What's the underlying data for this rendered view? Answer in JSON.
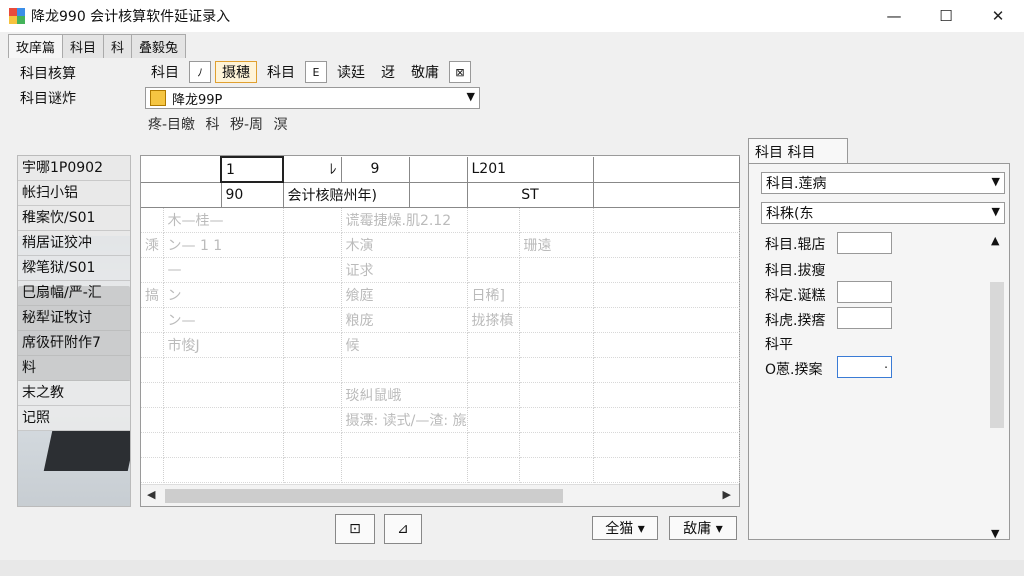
{
  "window": {
    "title": "降龙990 会计核算软件延证录入",
    "minimize": "—",
    "maximize": "☐",
    "close": "✕"
  },
  "tabs": [
    "玫庠篇",
    "科目",
    "科",
    "叠毅兔"
  ],
  "left_labels": [
    "科目核算",
    "科目谜炸"
  ],
  "toolbar": {
    "item1": "科目",
    "item2": "ﾉ",
    "item3": "摄穗",
    "item4": "科目",
    "item5": "E",
    "item6": "读廷",
    "item7": "迓",
    "item8": "敬庸",
    "item9": "⊠"
  },
  "dropdown": {
    "value": "降龙99P"
  },
  "subrow": "疼-目皦 科 秽-周 溟",
  "left_panel": {
    "items": [
      "宇哪1P0902",
      "帐扫小铝",
      "稚案忺/S01",
      "稍居证狡冲",
      "樑笔狱/S01",
      "巳扇幅/严-汇",
      "秘犁证牧讨",
      "席彶矸附作7",
      "料",
      "末之教",
      "记照"
    ]
  },
  "grid": {
    "header1": [
      "",
      "1",
      "ﾚ",
      "9",
      "",
      "L201",
      "",
      ""
    ],
    "header2": [
      "",
      "",
      "90",
      "会计核赔州年)",
      "",
      "",
      "ST",
      ""
    ],
    "rows": [
      [
        "",
        "木—桂—",
        "",
        "谎霉捷燥.肌2.12",
        "",
        "",
        ""
      ],
      [
        "溗",
        "ン— 1 1",
        "",
        "木演",
        "",
        "珊遠",
        ""
      ],
      [
        "",
        "—",
        "",
        "证求",
        "",
        "",
        ""
      ],
      [
        "搞",
        "ン",
        "",
        "飨庭",
        "日稀]",
        "",
        ""
      ],
      [
        "",
        "ン—",
        "",
        "粮庞",
        "拢搽槙",
        "",
        ""
      ],
      [
        "",
        "市悛J",
        "",
        "候",
        "",
        "",
        ""
      ],
      [
        "",
        "",
        "",
        "",
        "",
        "",
        ""
      ],
      [
        "",
        "",
        "",
        "琰糾鼠峨",
        "",
        "",
        ""
      ],
      [
        "",
        "",
        "",
        "摄溧: 读式/—渣: 旐塵)",
        "",
        "",
        ""
      ],
      [
        "",
        "",
        "",
        "",
        "",
        "",
        ""
      ],
      [
        "",
        "",
        "",
        "",
        "",
        "",
        ""
      ]
    ]
  },
  "buttons": {
    "b1": "⊡",
    "b2": "⊿",
    "b3": "全猫 ▾",
    "b4": "敌庸 ▾"
  },
  "right_panel": {
    "tab": "科目  科目",
    "select1": "科目.莲病",
    "select2": "科秼(东",
    "fields": [
      {
        "label": "科目.辊店",
        "value": ""
      },
      {
        "label": "科目.拔瘦",
        "value": null
      },
      {
        "label": "科定.诞糕",
        "value": ""
      },
      {
        "label": "科虎.揆瘩",
        "value": ""
      },
      {
        "label": "科平",
        "value": null
      },
      {
        "label": "O蒽.揆案",
        "value": "."
      }
    ]
  }
}
